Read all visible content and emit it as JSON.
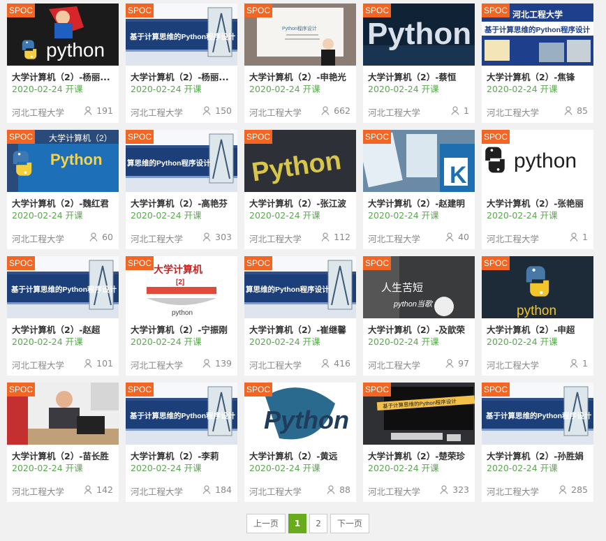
{
  "spoc_label": "SPOC",
  "colors": {
    "spoc": "#f26522",
    "date": "#59a84e",
    "active_page": "#6aaa1e"
  },
  "courses": [
    {
      "title": "大学计算机（2）-杨丽...",
      "date": "2020-02-24 开课",
      "school": "河北工程大学",
      "count": "191",
      "thumb": "python-hero"
    },
    {
      "title": "大学计算机（2）-杨丽...",
      "date": "2020-02-24 开课",
      "school": "河北工程大学",
      "count": "150",
      "thumb": "banner",
      "thumb_texts": [
        "基于计算思维的Python程序设计"
      ]
    },
    {
      "title": "大学计算机（2）-申艳光",
      "date": "2020-02-24 开课",
      "school": "河北工程大学",
      "count": "662",
      "thumb": "teacher-screen",
      "thumb_texts": [
        "Python程序设计"
      ]
    },
    {
      "title": "大学计算机（2）-蔡恒",
      "date": "2020-02-24 开课",
      "school": "河北工程大学",
      "count": "1",
      "thumb": "python-dark",
      "thumb_texts": [
        "Python"
      ]
    },
    {
      "title": "大学计算机（2）-焦锋",
      "date": "2020-02-24 开课",
      "school": "河北工程大学",
      "count": "85",
      "thumb": "hebeu",
      "thumb_texts": [
        "河北工程大学",
        "基于计算思维的Python程序设计"
      ]
    },
    {
      "title": "大学计算机（2）-魏红君",
      "date": "2020-02-24 开课",
      "school": "河北工程大学",
      "count": "60",
      "thumb": "laptop-python",
      "thumb_texts": [
        "大学计算机（2）",
        "Python"
      ]
    },
    {
      "title": "大学计算机（2）-高艳芬",
      "date": "2020-02-24 开课",
      "school": "河北工程大学",
      "count": "303",
      "thumb": "banner-crop",
      "thumb_texts": [
        "算思维的Python程序设计"
      ]
    },
    {
      "title": "大学计算机（2）-张江波",
      "date": "2020-02-24 开课",
      "school": "河北工程大学",
      "count": "112",
      "thumb": "python-gold",
      "thumb_texts": [
        "Python"
      ]
    },
    {
      "title": "大学计算机（2）-赵建明",
      "date": "2020-02-24 开课",
      "school": "河北工程大学",
      "count": "40",
      "thumb": "books"
    },
    {
      "title": "大学计算机（2）-张艳丽",
      "date": "2020-02-24 开课",
      "school": "河北工程大学",
      "count": "1",
      "thumb": "python-logo-white",
      "thumb_texts": [
        "python"
      ]
    },
    {
      "title": "大学计算机（2）-赵超",
      "date": "2020-02-24 开课",
      "school": "河北工程大学",
      "count": "101",
      "thumb": "banner",
      "thumb_texts": [
        "基于计算思维的Python程序设计"
      ]
    },
    {
      "title": "大学计算机（2）-宁振刚",
      "date": "2020-02-24 开课",
      "school": "河北工程大学",
      "count": "139",
      "thumb": "dxjsj",
      "thumb_texts": [
        "大学计算机",
        "[2]",
        "python"
      ]
    },
    {
      "title": "大学计算机（2）-崔继馨",
      "date": "2020-02-24 开课",
      "school": "河北工程大学",
      "count": "416",
      "thumb": "banner-crop",
      "thumb_texts": [
        "算思维的Python程序设计"
      ]
    },
    {
      "title": "大学计算机（2）-及歆荣",
      "date": "2020-02-24 开课",
      "school": "河北工程大学",
      "count": "97",
      "thumb": "rsky",
      "thumb_texts": [
        "人生苦短",
        "python当歌"
      ]
    },
    {
      "title": "大学计算机（2）-申超",
      "date": "2020-02-24 开课",
      "school": "河北工程大学",
      "count": "1",
      "thumb": "python-logo-dark",
      "thumb_texts": [
        "python"
      ]
    },
    {
      "title": "大学计算机（2）-苗长胜",
      "date": "2020-02-24 开课",
      "school": "河北工程大学",
      "count": "142",
      "thumb": "man-desk"
    },
    {
      "title": "大学计算机（2）-李莉",
      "date": "2020-02-24 开课",
      "school": "河北工程大学",
      "count": "184",
      "thumb": "banner",
      "thumb_texts": [
        "基于计算思维的Python程序设计"
      ]
    },
    {
      "title": "大学计算机（2）-黄远",
      "date": "2020-02-24 开课",
      "school": "河北工程大学",
      "count": "88",
      "thumb": "python-script",
      "thumb_texts": [
        "Python"
      ]
    },
    {
      "title": "大学计算机（2）-楚荣珍",
      "date": "2020-02-24 开课",
      "school": "河北工程大学",
      "count": "323",
      "thumb": "imac",
      "thumb_texts": [
        "基于计算思维的Python程序设计"
      ]
    },
    {
      "title": "大学计算机（2）-孙胜娟",
      "date": "2020-02-24 开课",
      "school": "河北工程大学",
      "count": "285",
      "thumb": "banner",
      "thumb_texts": [
        "基于计算思维的Python程序设计"
      ]
    }
  ],
  "pagination": {
    "prev": "上一页",
    "pages": [
      "1",
      "2"
    ],
    "current": "1",
    "next": "下一页"
  }
}
